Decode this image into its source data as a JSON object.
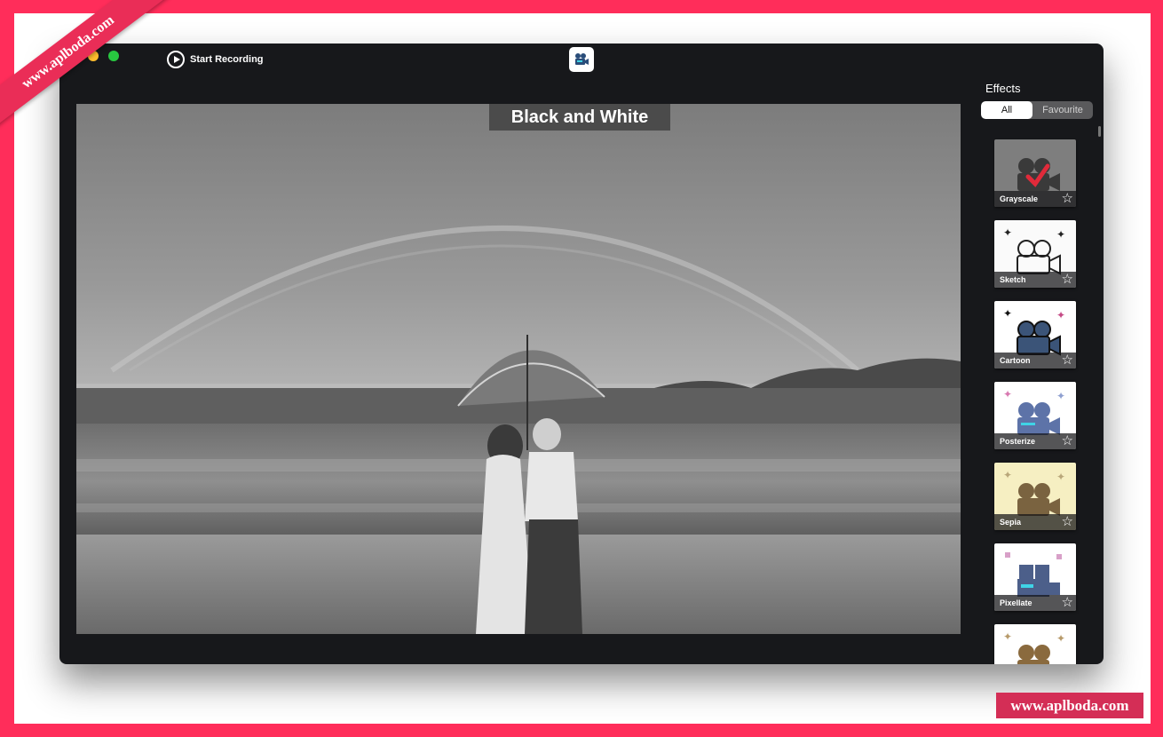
{
  "toolbar": {
    "record_label": "Start Recording",
    "app_icon": "video-camera-icon"
  },
  "preview": {
    "effect_title": "Black and White"
  },
  "sidebar": {
    "title": "Effects",
    "filter_all": "All",
    "filter_favourite": "Favourite",
    "effects": [
      {
        "label": "Grayscale",
        "selected": true
      },
      {
        "label": "Sketch"
      },
      {
        "label": "Cartoon"
      },
      {
        "label": "Posterize"
      },
      {
        "label": "Sepia"
      },
      {
        "label": "Pixellate"
      },
      {
        "label": ""
      }
    ]
  },
  "watermark": {
    "ribbon": "www.aplboda.com",
    "badge": "www.aplboda.com"
  },
  "colors": {
    "frame": "#ff2d5a",
    "window": "#17181b",
    "watermark": "#d42e56"
  }
}
